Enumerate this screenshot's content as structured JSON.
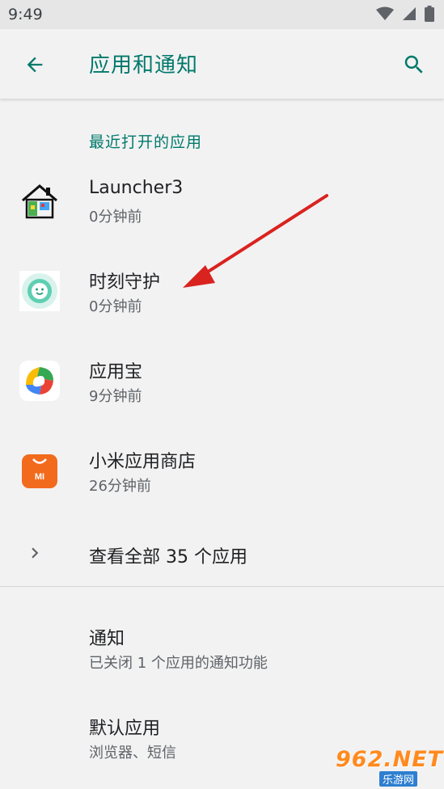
{
  "status_bar": {
    "time": "9:49"
  },
  "app_bar": {
    "title": "应用和通知",
    "back_icon": "arrow-back-icon",
    "search_icon": "search-icon"
  },
  "recent": {
    "header": "最近打开的应用",
    "apps": [
      {
        "name": "Launcher3",
        "time": "0分钟前",
        "icon": "launcher3-house-icon"
      },
      {
        "name": "时刻守护",
        "time": "0分钟前",
        "icon": "guardian-app-icon"
      },
      {
        "name": "应用宝",
        "time": "9分钟前",
        "icon": "yingyongbao-icon"
      },
      {
        "name": "小米应用商店",
        "time": "26分钟前",
        "icon": "mi-store-icon"
      }
    ]
  },
  "see_all": {
    "label": "查看全部 35 个应用"
  },
  "settings": [
    {
      "title": "通知",
      "subtitle": "已关闭 1 个应用的通知功能"
    },
    {
      "title": "默认应用",
      "subtitle": "浏览器、短信"
    }
  ],
  "mi_logo_text": "MI",
  "watermark": {
    "main": "962.NET",
    "sub": "乐游网"
  },
  "colors": {
    "accent": "#00796b",
    "background": "#f2f2f2",
    "annotation_arrow": "#d9231f"
  }
}
